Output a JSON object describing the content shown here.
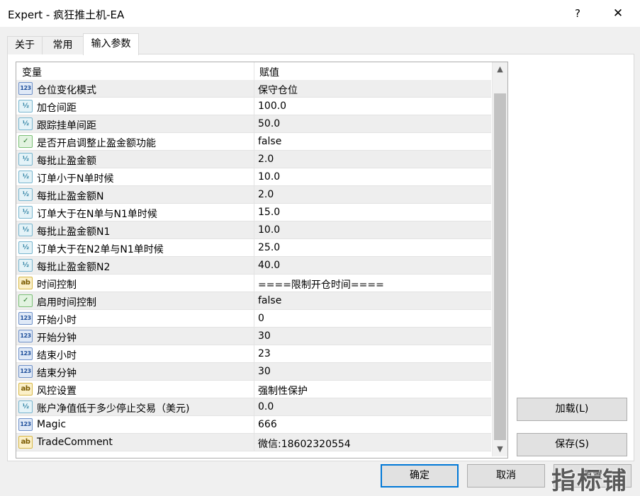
{
  "window": {
    "title": "Expert - 疯狂推土机-EA",
    "help": "?",
    "close": "✕"
  },
  "tabs": [
    {
      "label": "关于"
    },
    {
      "label": "常用"
    },
    {
      "label": "输入参数"
    }
  ],
  "grid": {
    "col_variable": "变量",
    "col_value": "赋值",
    "rows": [
      {
        "type": "int",
        "icon": "123",
        "name": "仓位变化模式",
        "value": "保守仓位"
      },
      {
        "type": "double",
        "icon": "½",
        "name": "加仓间距",
        "value": "100.0"
      },
      {
        "type": "double",
        "icon": "½",
        "name": "跟踪挂单间距",
        "value": "50.0"
      },
      {
        "type": "bool",
        "icon": "✓",
        "name": "是否开启调整止盈金额功能",
        "value": "false"
      },
      {
        "type": "double",
        "icon": "½",
        "name": "每批止盈金额",
        "value": "2.0"
      },
      {
        "type": "double",
        "icon": "½",
        "name": "订单小于N单时候",
        "value": "10.0"
      },
      {
        "type": "double",
        "icon": "½",
        "name": "每批止盈金额N",
        "value": "2.0"
      },
      {
        "type": "double",
        "icon": "½",
        "name": "订单大于在N单与N1单时候",
        "value": "15.0"
      },
      {
        "type": "double",
        "icon": "½",
        "name": "每批止盈金额N1",
        "value": "10.0"
      },
      {
        "type": "double",
        "icon": "½",
        "name": "订单大于在N2单与N1单时候",
        "value": "25.0"
      },
      {
        "type": "double",
        "icon": "½",
        "name": "每批止盈金额N2",
        "value": "40.0"
      },
      {
        "type": "string",
        "icon": "ab",
        "name": "时间控制",
        "value": "====限制开仓时间===="
      },
      {
        "type": "bool",
        "icon": "✓",
        "name": "启用时间控制",
        "value": "false"
      },
      {
        "type": "int",
        "icon": "123",
        "name": "开始小时",
        "value": "0"
      },
      {
        "type": "int",
        "icon": "123",
        "name": "开始分钟",
        "value": "30"
      },
      {
        "type": "int",
        "icon": "123",
        "name": "结束小时",
        "value": "23"
      },
      {
        "type": "int",
        "icon": "123",
        "name": "结束分钟",
        "value": "30"
      },
      {
        "type": "string",
        "icon": "ab",
        "name": "风控设置",
        "value": "强制性保护"
      },
      {
        "type": "double",
        "icon": "½",
        "name": "账户净值低于多少停止交易（美元)",
        "value": "0.0"
      },
      {
        "type": "int",
        "icon": "123",
        "name": "Magic",
        "value": "666"
      },
      {
        "type": "string",
        "icon": "ab",
        "name": "TradeComment",
        "value": "微信:18602320554"
      }
    ]
  },
  "buttons": {
    "load": "加载(L)",
    "save": "保存(S)",
    "ok": "确定",
    "cancel": "取消",
    "reset": "重置"
  },
  "watermark": "指标铺"
}
